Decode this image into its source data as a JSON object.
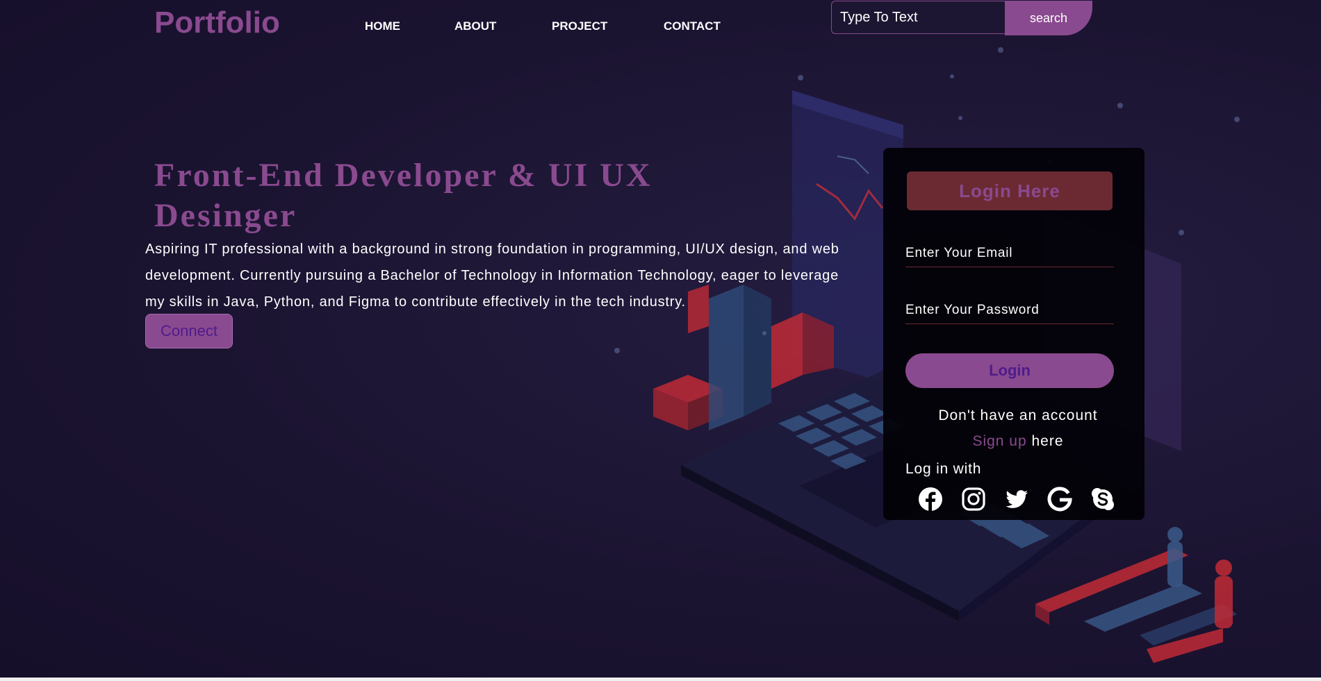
{
  "header": {
    "logo": "Portfolio",
    "nav": [
      {
        "label": "HOME"
      },
      {
        "label": "ABOUT"
      },
      {
        "label": "PROJECT"
      },
      {
        "label": "CONTACT"
      }
    ],
    "search": {
      "placeholder": "Type To Text",
      "button_label": "search"
    }
  },
  "hero": {
    "headline": "Front-End Developer & UI UX Desinger",
    "about": "Aspiring IT professional with a background in strong foundation in programming, UI/UX design, and web development. Currently pursuing a Bachelor of Technology in Information Technology, eager to leverage my skills in Java, Python, and Figma to contribute effectively in the tech industry.",
    "connect_label": "Connect"
  },
  "login": {
    "title": "Login Here",
    "email_placeholder": "Enter Your Email",
    "password_placeholder": "Enter Your Password",
    "button_label": "Login",
    "no_account": "Don't have an account",
    "signup_link": "Sign up",
    "signup_suffix": " here",
    "login_with": "Log in with",
    "socials": [
      "facebook-icon",
      "instagram-icon",
      "twitter-icon",
      "google-icon",
      "skype-icon"
    ]
  },
  "colors": {
    "accent": "#8a4a8f",
    "background": "#1c1632",
    "card": "#020106",
    "title_bg": "#6b2a32"
  }
}
